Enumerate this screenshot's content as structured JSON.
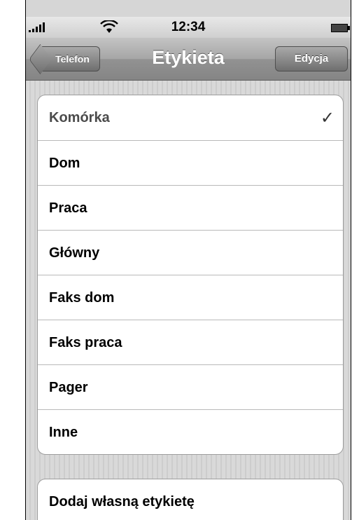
{
  "status_bar": {
    "time": "12:34",
    "signal_icon": "signal-bars-icon",
    "wifi_icon": "wifi-icon",
    "battery_icon": "battery-icon"
  },
  "navbar": {
    "back_label": "Telefon",
    "title": "Etykieta",
    "edit_label": "Edycja"
  },
  "labels": [
    {
      "label": "Komórka",
      "selected": true
    },
    {
      "label": "Dom",
      "selected": false
    },
    {
      "label": "Praca",
      "selected": false
    },
    {
      "label": "Główny",
      "selected": false
    },
    {
      "label": "Faks dom",
      "selected": false
    },
    {
      "label": "Faks praca",
      "selected": false
    },
    {
      "label": "Pager",
      "selected": false
    },
    {
      "label": "Inne",
      "selected": false
    }
  ],
  "checkmark": "✓",
  "custom_label": "Dodaj własną etykietę",
  "colors": {
    "navbar": "#9a9a9a",
    "background": "#d6d6d6",
    "selected_text": "#4b4b4b"
  }
}
